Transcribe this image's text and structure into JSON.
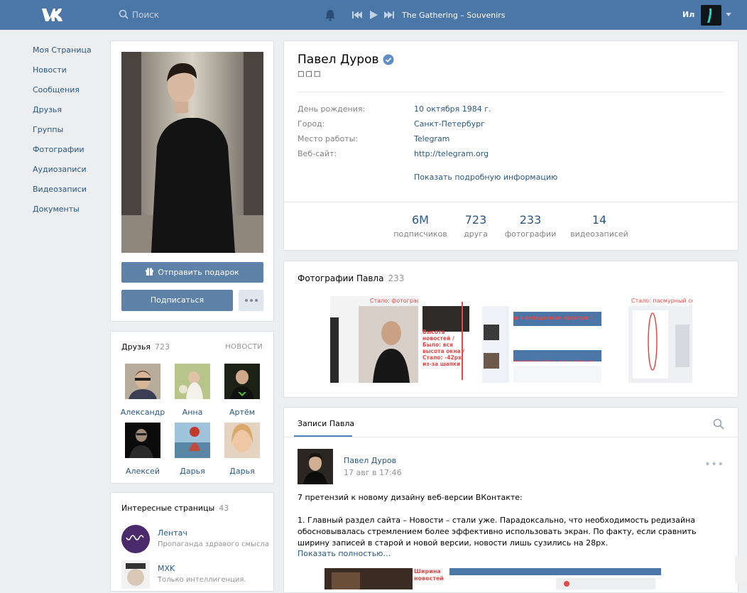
{
  "header": {
    "search_placeholder": "Поиск",
    "track": "The Gathering – Souvenirs",
    "user_short": "Ил",
    "bg_color": "#4a76a8"
  },
  "nav": [
    "Моя Страница",
    "Новости",
    "Сообщения",
    "Друзья",
    "Группы",
    "Фотографии",
    "Аудиозаписи",
    "Видеозаписи",
    "Документы"
  ],
  "profile_actions": {
    "gift": "Отправить подарок",
    "subscribe": "Подписаться",
    "more": "•••"
  },
  "friends": {
    "title": "Друзья",
    "count": "723",
    "link": "НОВОСТИ",
    "items": [
      "Александр",
      "Анна",
      "Артём",
      "Алексей",
      "Дарья",
      "Дарья"
    ]
  },
  "pages": {
    "title": "Интересные страницы",
    "count": "43",
    "items": [
      {
        "name": "Лентач",
        "desc": "Пропаганда здравого смысла"
      },
      {
        "name": "MXK",
        "desc": "Только интеллигенция."
      }
    ]
  },
  "profile": {
    "name": "Павел Дуров",
    "status": "□□□",
    "info": [
      {
        "label": "День рождения:",
        "value": "10 октября 1984 г."
      },
      {
        "label": "Город:",
        "value": "Санкт-Петербург"
      },
      {
        "label": "Место работы:",
        "value": "Telegram"
      },
      {
        "label": "Веб-сайт:",
        "value": "http://telegram.org"
      }
    ],
    "show_more": "Показать подробную информацию",
    "counters": [
      {
        "num": "6M",
        "label": "подписчиков"
      },
      {
        "num": "723",
        "label": "друга"
      },
      {
        "num": "233",
        "label": "фотографии"
      },
      {
        "num": "14",
        "label": "видеозаписей"
      }
    ]
  },
  "photos": {
    "title": "Фотографии Павла",
    "count": "233",
    "thumbs": [
      {
        "caption": "Стало: фотографи"
      },
      {
        "caption": "Высота новостей / Было: вся высота окна / Стало: -42px из-за шапки"
      },
      {
        "caption": "ы в отведенное простра / пространстве, ни с чем не сочета"
      },
      {
        "caption": "Стало: пасмурный серый"
      }
    ]
  },
  "wall": {
    "tab": "Записи Павла",
    "post": {
      "author": "Павел Дуров",
      "date": "17 авг в 17:46",
      "more": "•••",
      "line1": "7 претензий к новому дизайну веб-версии ВКонтакте:",
      "line2": "1. Главный раздел сайта – Новости – стали уже. Парадоксально, что необходимость редизайна обосновывалась стремлением более эффективно использовать экран. По факту, если сравнить ширину записей в старой и новой версии, новости лишь сузились на 28px.",
      "show_full": "Показать полностью…",
      "image_caption": "Ширина новостей"
    }
  }
}
